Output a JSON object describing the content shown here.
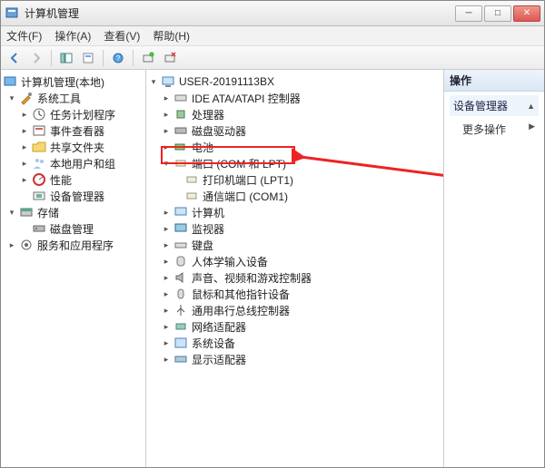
{
  "window": {
    "title": "计算机管理"
  },
  "menu": {
    "file": "文件(F)",
    "action": "操作(A)",
    "view": "查看(V)",
    "help": "帮助(H)"
  },
  "actions": {
    "header": "操作",
    "group": "设备管理器",
    "more": "更多操作"
  },
  "leftTree": {
    "root": "计算机管理(本地)",
    "sysTools": "系统工具",
    "taskScheduler": "任务计划程序",
    "eventViewer": "事件查看器",
    "sharedFolders": "共享文件夹",
    "localUsers": "本地用户和组",
    "performance": "性能",
    "deviceMgr": "设备管理器",
    "storage": "存储",
    "diskMgmt": "磁盘管理",
    "services": "服务和应用程序"
  },
  "midTree": {
    "root": "USER-20191113BX",
    "ide": "IDE ATA/ATAPI 控制器",
    "cpu": "处理器",
    "diskDrives": "磁盘驱动器",
    "battery": "电池",
    "ports": "端口 (COM 和 LPT)",
    "lpt1": "打印机端口 (LPT1)",
    "com1": "通信端口 (COM1)",
    "computer": "计算机",
    "monitor": "监视器",
    "keyboard": "键盘",
    "hid": "人体学输入设备",
    "audio": "声音、视频和游戏控制器",
    "mouse": "鼠标和其他指针设备",
    "usb": "通用串行总线控制器",
    "network": "网络适配器",
    "system": "系统设备",
    "display": "显示适配器"
  },
  "colors": {
    "highlight": "#e22"
  }
}
